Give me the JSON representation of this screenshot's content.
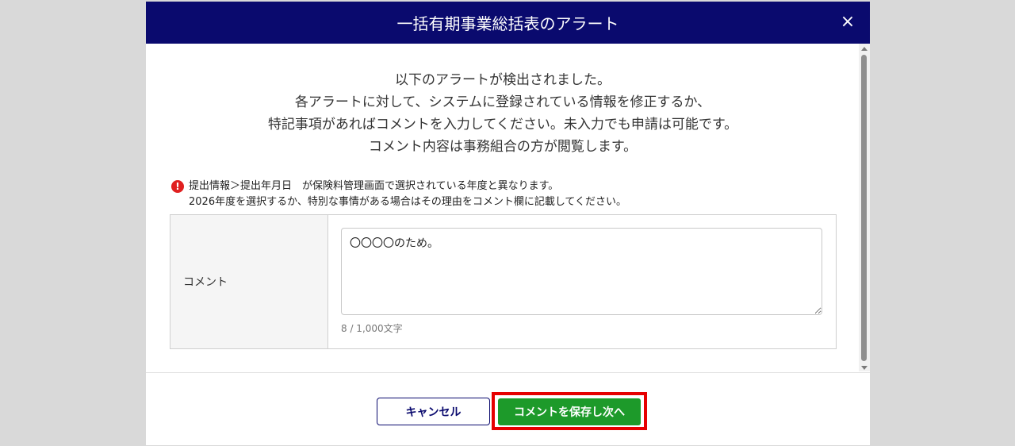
{
  "modal": {
    "title": "一括有期事業総括表のアラート",
    "close_symbol": "×"
  },
  "intro": {
    "lines": [
      "以下のアラートが検出されました。",
      "各アラートに対して、システムに登録されている情報を修正するか、",
      "特記事項があればコメントを入力してください。未入力でも申請は可能です。",
      "コメント内容は事務組合の方が閲覧します。"
    ]
  },
  "alert": {
    "icon_symbol": "!",
    "line1": "提出情報＞提出年月日　が保険料管理画面で選択されている年度と異なります。",
    "line2": "2026年度を選択するか、特別な事情がある場合はその理由をコメント欄に記載してください。"
  },
  "comment": {
    "label": "コメント",
    "value": "〇〇〇〇のため。",
    "char_count": "8 / 1,000文字"
  },
  "footer": {
    "cancel_label": "キャンセル",
    "save_label": "コメントを保存し次へ"
  },
  "colors": {
    "header_bg": "#0a0a6e",
    "save_button": "#1d9a2a",
    "highlight": "#e60000",
    "alert_icon": "#e02020"
  }
}
